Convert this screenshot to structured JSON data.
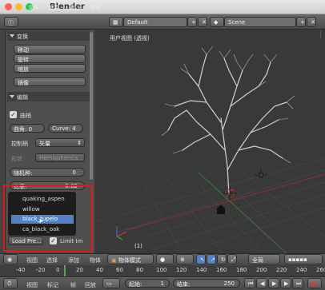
{
  "window": {
    "title": "Blender"
  },
  "menubar": {
    "menus": [
      "文件",
      "渲染",
      "窗口",
      "帮助"
    ],
    "layout": "Default",
    "scene": "Scene"
  },
  "toolshelf": {
    "transform_header": "变换",
    "transform_buttons": [
      "移动",
      "旋转",
      "缩放"
    ],
    "mirror_button": "镜像",
    "edit_header": "编辑",
    "panel_checkbox_label": "曲梢",
    "angle_field": "曲角: 0",
    "curve_field": "Curve: 4",
    "handle_label": "控制柄",
    "handle_value": "矢量",
    "shape_label": "形状",
    "shape_value": "Hemispherica...",
    "seed_field": "随机种:",
    "seed_value": "0",
    "ratio_field": "比率:",
    "ratio_value": "0.02"
  },
  "preset_menu": {
    "items": [
      "quaking_aspen",
      "willow",
      "black_tupelo",
      "ca_black_oak"
    ],
    "highlighted": "black_tupelo",
    "load_button": "Load Pre...",
    "limit_label": "Limit Im"
  },
  "viewport": {
    "label": "用户视图 (透视)",
    "frame_indicator": "(1)"
  },
  "viewport_header": {
    "items": [
      "视图",
      "选择",
      "添加",
      "物体"
    ],
    "mode": "物体模式",
    "orientation": "全局"
  },
  "timeline": {
    "ticks": [
      "-40",
      "-20",
      "0",
      "20",
      "40",
      "60",
      "80",
      "100",
      "120",
      "140",
      "160",
      "180",
      "200",
      "220",
      "240",
      "260"
    ],
    "menus": [
      "视图",
      "标记",
      "帧",
      "回放"
    ],
    "start_label": "起始:",
    "start_value": "1",
    "end_label": "结束:",
    "end_value": "250"
  },
  "colors": {
    "accent": "#5680c2",
    "highlight_box": "#e01818"
  }
}
